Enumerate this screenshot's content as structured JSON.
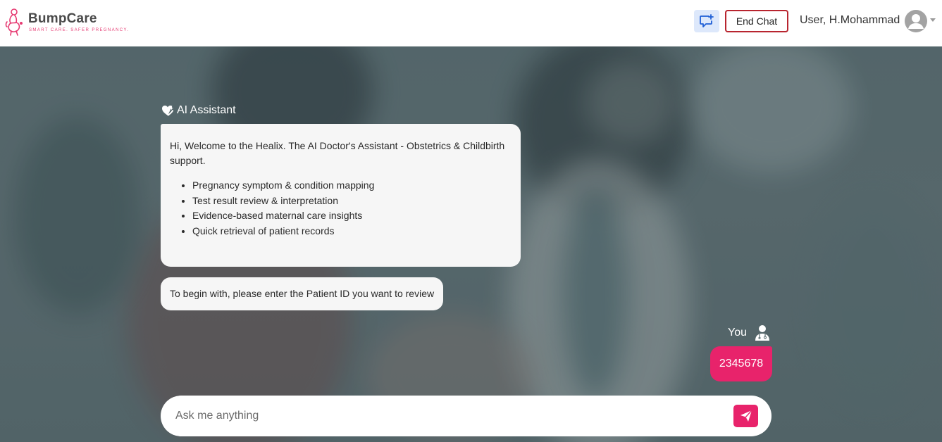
{
  "header": {
    "brand_name": "BumpCare",
    "brand_tagline": "SMART CARE. SAFER PREGNANCY.",
    "new_chat_icon": "chat-plus-icon",
    "end_chat_label": "End Chat",
    "user_name": "User, H.Mohammad",
    "avatar_icon": "user-avatar-icon"
  },
  "chat": {
    "assistant_label": "AI Assistant",
    "assistant_icon": "heart-sparkle-icon",
    "welcome_text": "Hi, Welcome to the Healix. The AI Doctor's Assistant - Obstetrics & Childbirth support.",
    "features": [
      "Pregnancy symptom & condition mapping",
      "Test result review & interpretation",
      "Evidence-based maternal care insights",
      "Quick retrieval of patient records"
    ],
    "prompt_text": "To begin with, please enter the Patient ID you want to review",
    "user_label": "You",
    "user_icon": "doctor-icon",
    "user_message": "2345678"
  },
  "input": {
    "placeholder": "Ask me anything",
    "value": "",
    "send_icon": "send-icon"
  },
  "colors": {
    "accent": "#e8236b",
    "end_chat_border": "#b8252f",
    "new_chat_bg": "#dde8fb"
  }
}
